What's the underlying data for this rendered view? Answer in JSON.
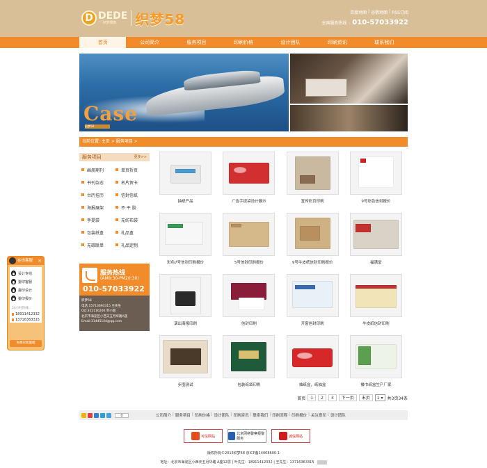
{
  "header": {
    "logo_badge": "D",
    "logo_dede": "DEDE",
    "logo_dede_sub": "一 织梦模板",
    "site_name": "织梦58",
    "links": [
      "百度地图",
      "谷歌地图",
      "RSS订阅"
    ],
    "hotline_label": "全国服务热线",
    "hotline_number": "010-57033922"
  },
  "nav": {
    "items": [
      "首页",
      "公司简介",
      "服务项目",
      "印刷价格",
      "设计团队",
      "印刷资讯",
      "联系我们"
    ],
    "active_index": 0
  },
  "banner": {
    "headline": "Case",
    "subtitle": "织梦58"
  },
  "breadcrumb": {
    "text": "当前位置: 主页 > 服务项目 >"
  },
  "sidebar": {
    "title": "服务项目",
    "more": "更多>>",
    "items": [
      "画册期刊",
      "单页折页",
      "书刊杂志",
      "名片贺卡",
      "台历挂历",
      "信封信纸",
      "海报展架",
      "不 干 胶",
      "手提袋",
      "无纺布袋",
      "包装纸盒",
      "礼品盒",
      "无碳联单",
      "礼品定制"
    ]
  },
  "hotline_box": {
    "title": "服务热线",
    "hours": "(AM8:30-PM20:30)",
    "number": "010-57033922",
    "info": [
      "织梦58",
      "电话:15713693315 王先生",
      "QQ:352116200 罗小姐",
      "北京市海淀区小西天五月华路A座",
      "Email:31445144@qq.com"
    ]
  },
  "gallery": {
    "items": [
      {
        "caption": "抽纸产品",
        "style": "tissue"
      },
      {
        "caption": "广告手提袋设计展示",
        "style": "redbox"
      },
      {
        "caption": "宣传彩页印刷",
        "style": "brochure"
      },
      {
        "caption": "9号彩色信封报价",
        "style": "envelope"
      },
      {
        "caption": "彩色7号信封印刷报价",
        "style": "whiteenv"
      },
      {
        "caption": "5号信封印刷报价",
        "style": "kraft"
      },
      {
        "caption": "9号牛皮纸信封印刷报价",
        "style": "kraft2"
      },
      {
        "caption": "福满堂",
        "style": "calendar"
      },
      {
        "caption": "演出海报印刷",
        "style": "poster"
      },
      {
        "caption": "信封印刷",
        "style": "card"
      },
      {
        "caption": "开窗信封印刷",
        "style": "windowenv"
      },
      {
        "caption": "牛皮纸信封印刷",
        "style": "envelope2"
      },
      {
        "caption": "步图测试",
        "style": "ink"
      },
      {
        "caption": "包装纸袋印刷",
        "style": "green"
      },
      {
        "caption": "抽纸盒，纸抽盒",
        "style": "redbox2"
      },
      {
        "caption": "餐巾纸盒生产厂家",
        "style": "napkin"
      }
    ]
  },
  "pager": {
    "home": "首页",
    "pages": [
      "1",
      "2",
      "3"
    ],
    "next": "下一页",
    "last": "末页",
    "select": "1",
    "summary": "共3页34条"
  },
  "footer": {
    "share_count": "0",
    "links": [
      "公司简介",
      "服务项目",
      "印刷价格",
      "设计团队",
      "印刷资讯",
      "联系我们",
      "印刷流程",
      "印刷报价",
      "关注意印",
      "设计团队"
    ],
    "badges": [
      "可信网站",
      "北京网络警察报警服务",
      "诚信网站"
    ],
    "copyright": "版权所有©2013织梦58 京ICP备14008600-1",
    "address": "地址：北京市海淀区小西天五月华路 A座12层 | 叶先生：18911412332 | 王先生：13716363315"
  },
  "qq": {
    "title": "在线客服",
    "close": "×",
    "agents": [
      "设计专线",
      "委印客服",
      "委印设计",
      "委印报价"
    ],
    "sub": "24小时热线...",
    "phones": [
      "18911412332",
      "13716363315"
    ],
    "footer": "免费的客服端"
  },
  "colors": {
    "orange": "#f28c2a",
    "tan": "#d8bf98",
    "dark": "#6b5d51"
  }
}
